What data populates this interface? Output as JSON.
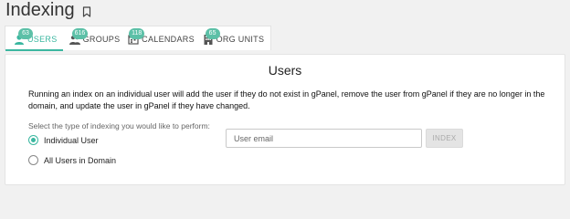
{
  "page": {
    "title": "Indexing"
  },
  "tabs": [
    {
      "label": "USERS",
      "badge": "63",
      "active": true,
      "icon": "user-icon"
    },
    {
      "label": "GROUPS",
      "badge": "616",
      "active": false,
      "icon": "group-icon"
    },
    {
      "label": "CALENDARS",
      "badge": "118",
      "active": false,
      "icon": "calendar-icon"
    },
    {
      "label": "ORG UNITS",
      "badge": "65",
      "active": false,
      "icon": "building-icon"
    }
  ],
  "panel": {
    "title": "Users",
    "description": "Running an index on an individual user will add the user if they do not exist in gPanel, remove the user from gPanel if they are no longer in the domain, and update the user in gPanel if they have changed.",
    "prompt": "Select the type of indexing you would like to perform:",
    "options": [
      {
        "label": "Individual User",
        "checked": true
      },
      {
        "label": "All Users in Domain",
        "checked": false
      }
    ],
    "email_placeholder": "User email",
    "email_value": "",
    "index_button": "INDEX"
  },
  "colors": {
    "accent": "#3bb7a0",
    "badge": "#5cc0a7"
  }
}
